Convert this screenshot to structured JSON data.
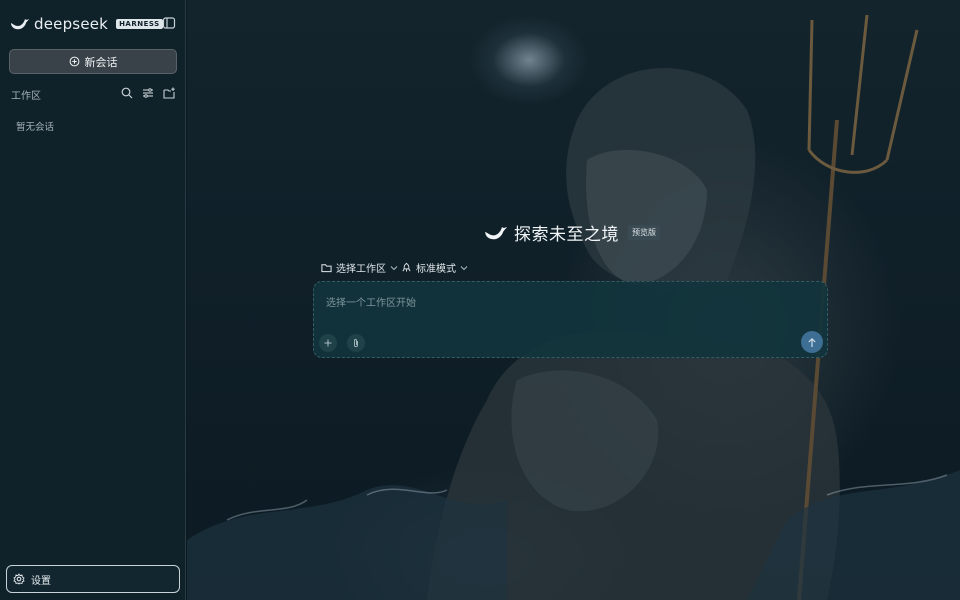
{
  "sidebar": {
    "brand": "deepseek",
    "brand_tag": "HARNESS",
    "new_chat_label": "新会话",
    "workspace_label": "工作区",
    "empty_label": "暂无会话",
    "settings_label": "设置",
    "icons": [
      "logo-icon",
      "sidebar-toggle-icon",
      "plus-circle-icon",
      "search-icon",
      "filter-icon",
      "new-folder-icon",
      "gear-icon"
    ]
  },
  "main": {
    "hero_title": "探索未至之境",
    "preview_badge": "预览版",
    "workspace_select": "选择工作区",
    "mode_select": "标准模式",
    "input_placeholder": "选择一个工作区开始",
    "icons": [
      "folder-icon",
      "chevron-down-icon",
      "mode-icon",
      "plus-icon",
      "paperclip-icon",
      "arrow-up-icon"
    ]
  },
  "colors": {
    "sidebar_bg": "#0f2129",
    "composer_bg": "#11343c",
    "send_button": "#3e6e93",
    "text": "#e6ecef"
  }
}
